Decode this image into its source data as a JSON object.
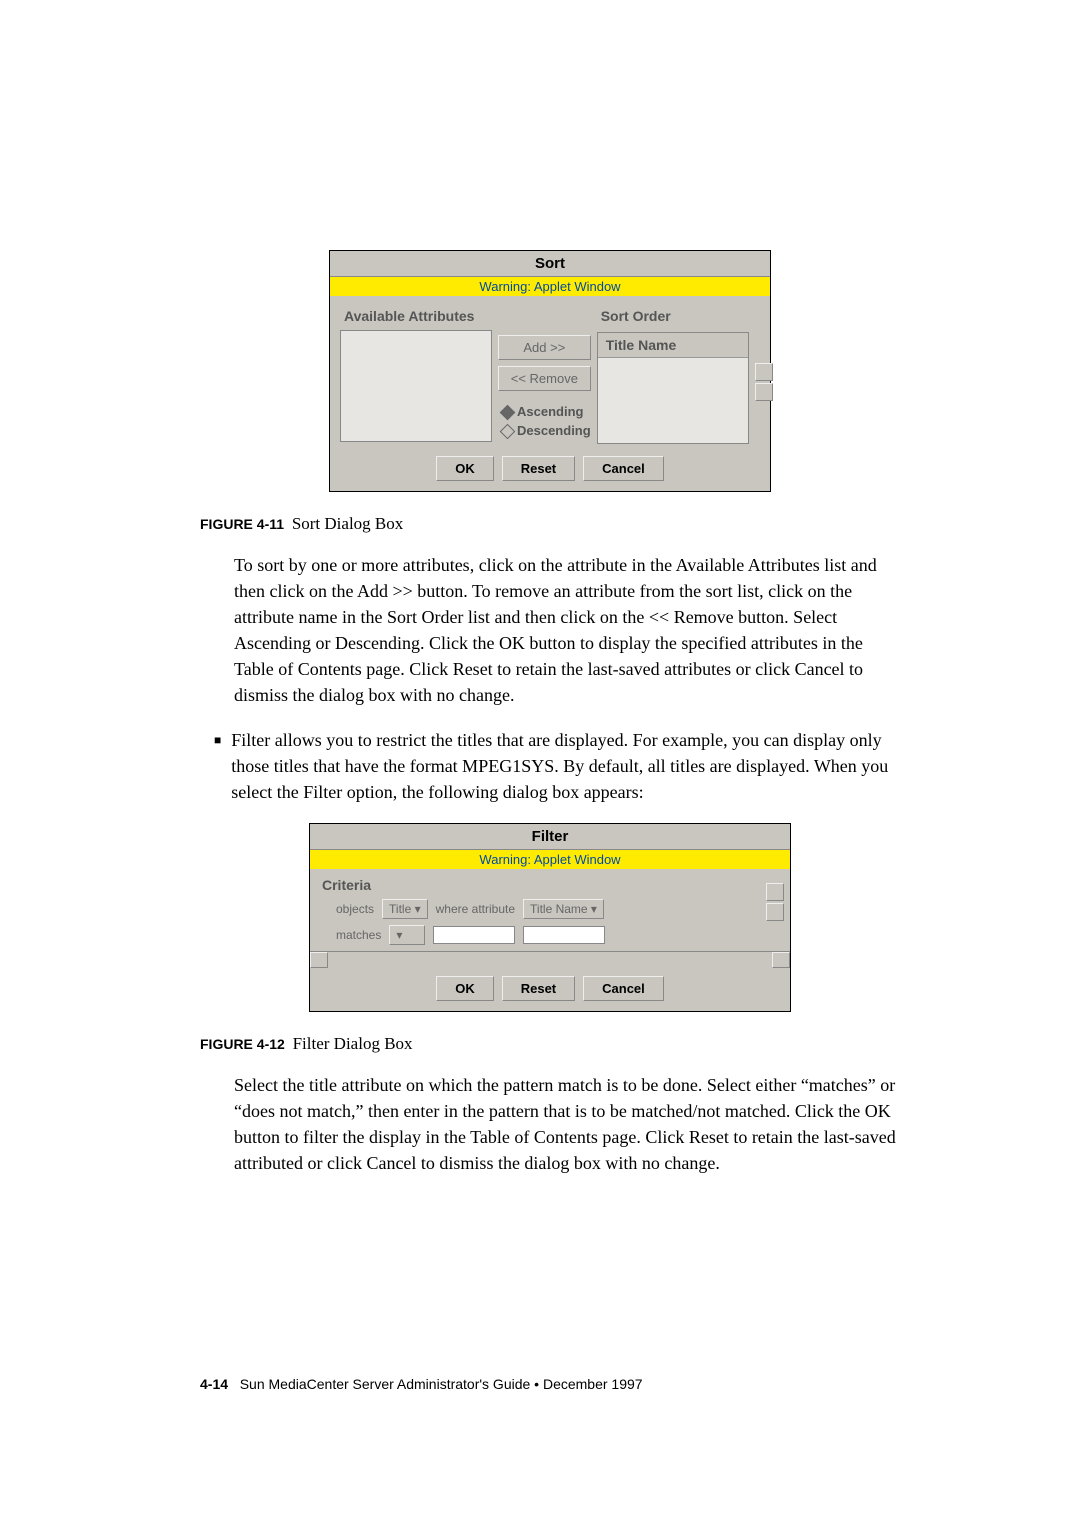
{
  "sortDialog": {
    "title": "Sort",
    "warning": "Warning: Applet Window",
    "leftLabel": "Available Attributes",
    "addBtn": "Add >>",
    "removeBtn": "<< Remove",
    "ascending": "Ascending",
    "descending": "Descending",
    "rightLabel": "Sort Order",
    "rightItem": "Title Name",
    "ok": "OK",
    "reset": "Reset",
    "cancel": "Cancel"
  },
  "caption1_num": "FIGURE 4-11",
  "caption1_text": "Sort Dialog Box",
  "para1": "To sort by one or more attributes, click on the attribute in the Available Attributes list and then click on the Add >> button. To remove an attribute from the sort list, click on the attribute name in the Sort Order list and then click on the << Remove button. Select Ascending or Descending. Click the OK button to display the specified attributes in the Table of Contents page. Click Reset to retain the last-saved attributes or click Cancel to dismiss the dialog box with no change.",
  "bullet1": "Filter allows you to restrict the titles that are displayed. For example, you can display only those titles that have the format MPEG1SYS. By default, all titles are displayed. When you select the Filter option, the following dialog box appears:",
  "filterDialog": {
    "title": "Filter",
    "warning": "Warning: Applet Window",
    "criteria": "Criteria",
    "objectsLbl": "objects",
    "titleSel": "Title",
    "whereLbl": "where attribute",
    "attrSel": "Title Name",
    "matchesLbl": "matches",
    "ok": "OK",
    "reset": "Reset",
    "cancel": "Cancel"
  },
  "caption2_num": "FIGURE 4-12",
  "caption2_text": "Filter Dialog Box",
  "para2": "Select the title attribute on which the pattern match is to be done. Select either “matches” or “does not match,” then enter in the pattern that is to be matched/not matched. Click the OK button to filter the display in the Table of Contents page. Click Reset to retain the last-saved attributed or click Cancel to dismiss the dialog box with no change.",
  "footer_page": "4-14",
  "footer_text": "Sun MediaCenter Server Administrator's Guide • December 1997"
}
